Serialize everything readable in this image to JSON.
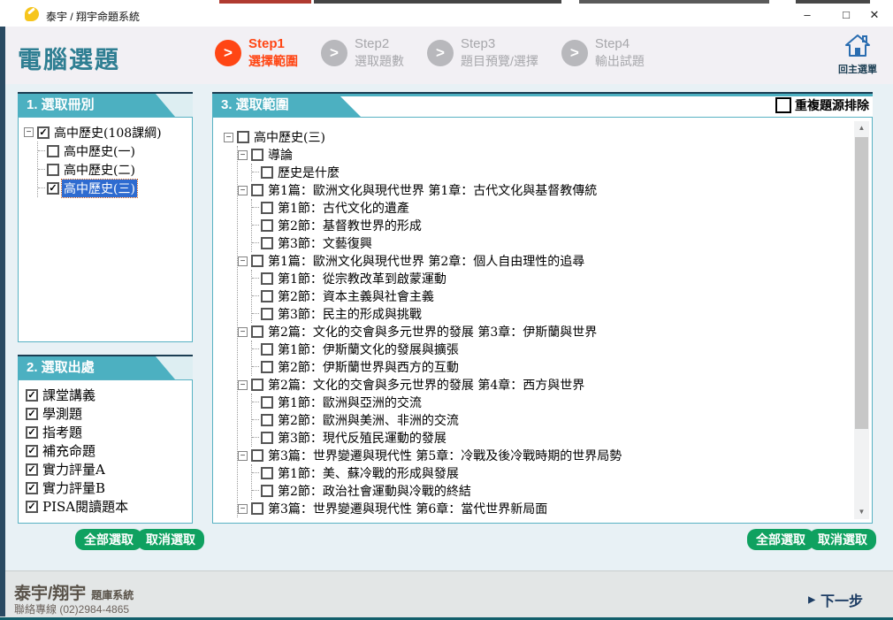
{
  "titlebar": {
    "title": "泰宇 / 翔宇命題系統",
    "minimize": "–",
    "maximize": "□",
    "close": "✕"
  },
  "header": {
    "page_title": "電腦選題",
    "steps": [
      {
        "name": "Step1",
        "label": "選擇範圍",
        "active": true
      },
      {
        "name": "Step2",
        "label": "選取題數",
        "active": false
      },
      {
        "name": "Step3",
        "label": "題目預覽/選擇",
        "active": false
      },
      {
        "name": "Step4",
        "label": "輸出試題",
        "active": false
      }
    ],
    "home_label": "回主選單"
  },
  "panel1": {
    "title": "1. 選取冊別",
    "tree": [
      {
        "label": "高中歷史(108課綱)",
        "checked": true,
        "expand": true,
        "children": [
          {
            "label": "高中歷史(一)",
            "checked": false
          },
          {
            "label": "高中歷史(二)",
            "checked": false
          },
          {
            "label": "高中歷史(三)",
            "checked": true,
            "selected": true
          }
        ]
      }
    ]
  },
  "panel2": {
    "title": "2. 選取出處",
    "items": [
      "課堂講義",
      "學測題",
      "指考題",
      "補充命題",
      "實力評量A",
      "實力評量B",
      "PISA閱讀題本"
    ],
    "select_all": "全部選取",
    "deselect": "取消選取"
  },
  "panel3": {
    "title": "3. 選取範圍",
    "dedupe_label": "重複題源排除",
    "dedupe_checked": false,
    "select_all": "全部選取",
    "deselect": "取消選取",
    "tree": [
      {
        "label": "高中歷史(三)",
        "checked": false,
        "expand": true,
        "children": [
          {
            "label": "導論",
            "checked": false,
            "expand": true,
            "children": [
              {
                "label": "歷史是什麼",
                "checked": false
              }
            ]
          },
          {
            "label": "第1篇：歐洲文化與現代世界 第1章：古代文化與基督教傳統",
            "checked": false,
            "expand": true,
            "children": [
              {
                "label": "第1節：古代文化的遺產",
                "checked": false
              },
              {
                "label": "第2節：基督教世界的形成",
                "checked": false
              },
              {
                "label": "第3節：文藝復興",
                "checked": false
              }
            ]
          },
          {
            "label": "第1篇：歐洲文化與現代世界 第2章：個人自由理性的追尋",
            "checked": false,
            "expand": true,
            "children": [
              {
                "label": "第1節：從宗教改革到啟蒙運動",
                "checked": false
              },
              {
                "label": "第2節：資本主義與社會主義",
                "checked": false
              },
              {
                "label": "第3節：民主的形成與挑戰",
                "checked": false
              }
            ]
          },
          {
            "label": "第2篇：文化的交會與多元世界的發展 第3章：伊斯蘭與世界",
            "checked": false,
            "expand": true,
            "children": [
              {
                "label": "第1節：伊斯蘭文化的發展與擴張",
                "checked": false
              },
              {
                "label": "第2節：伊斯蘭世界與西方的互動",
                "checked": false
              }
            ]
          },
          {
            "label": "第2篇：文化的交會與多元世界的發展 第4章：西方與世界",
            "checked": false,
            "expand": true,
            "children": [
              {
                "label": "第1節：歐洲與亞洲的交流",
                "checked": false
              },
              {
                "label": "第2節：歐洲與美洲、非洲的交流",
                "checked": false
              },
              {
                "label": "第3節：現代反殖民運動的發展",
                "checked": false
              }
            ]
          },
          {
            "label": "第3篇：世界變遷與現代性 第5章：冷戰及後冷戰時期的世界局勢",
            "checked": false,
            "expand": true,
            "children": [
              {
                "label": "第1節：美、蘇冷戰的形成與發展",
                "checked": false
              },
              {
                "label": "第2節：政治社會運動與冷戰的終結",
                "checked": false
              }
            ]
          },
          {
            "label": "第3篇：世界變遷與現代性 第6章：當代世界新局面",
            "checked": false,
            "expand": true,
            "children": []
          }
        ]
      }
    ]
  },
  "footer": {
    "brand": "泰宇/翔宇",
    "brand_suffix": "題庫系統",
    "contact": "聯絡專線 (02)2984-4865",
    "next_arrow": "▶",
    "next_label": "下一步"
  },
  "colors": {
    "accent_teal": "#4cb0c1",
    "dark_navy": "#1c3e53",
    "active_orange": "#ff4614",
    "inactive_gray": "#b8b8bc",
    "selection_blue": "#2e6bd0",
    "button_green": "#0fa160",
    "footer_strip": "#135f6b",
    "content_bg": "#e8f1f5"
  }
}
